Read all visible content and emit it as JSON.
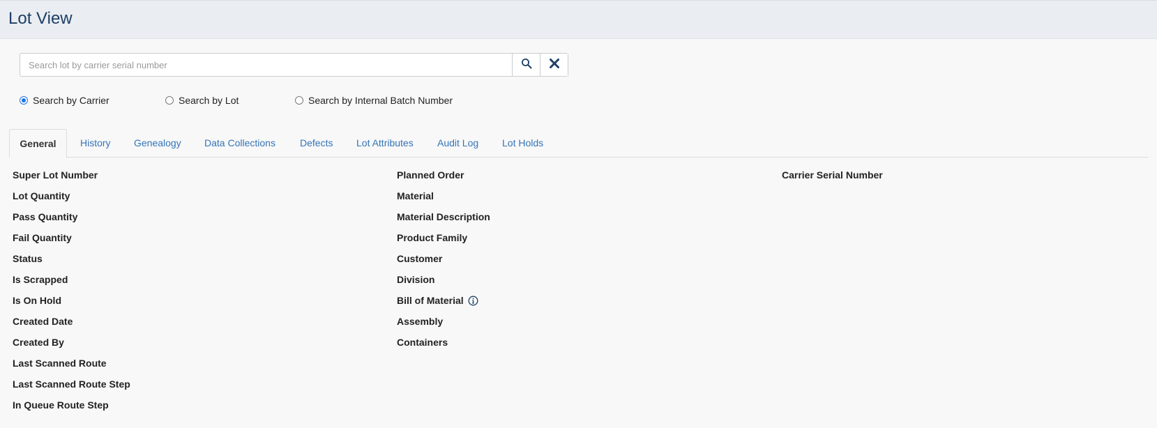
{
  "header": {
    "title": "Lot View"
  },
  "search": {
    "placeholder": "Search lot by carrier serial number",
    "value": "",
    "search_icon": "search-icon",
    "clear_icon": "close-icon"
  },
  "search_modes": [
    {
      "label": "Search by Carrier",
      "checked": true
    },
    {
      "label": "Search by Lot",
      "checked": false
    },
    {
      "label": "Search by Internal Batch Number",
      "checked": false
    }
  ],
  "tabs": [
    {
      "label": "General",
      "active": true
    },
    {
      "label": "History",
      "active": false
    },
    {
      "label": "Genealogy",
      "active": false
    },
    {
      "label": "Data Collections",
      "active": false
    },
    {
      "label": "Defects",
      "active": false
    },
    {
      "label": "Lot Attributes",
      "active": false
    },
    {
      "label": "Audit Log",
      "active": false
    },
    {
      "label": "Lot Holds",
      "active": false
    }
  ],
  "general": {
    "column1": [
      "Super Lot Number",
      "Lot Quantity",
      "Pass Quantity",
      "Fail Quantity",
      "Status",
      "Is Scrapped",
      "Is On Hold",
      "Created Date",
      "Created By",
      "Last Scanned Route",
      "Last Scanned Route Step",
      "In Queue Route Step"
    ],
    "column2": [
      "Planned Order",
      "Material",
      "Material Description",
      "Product Family",
      "Customer",
      "Division",
      "Bill of Material",
      "Assembly",
      "Containers"
    ],
    "column3": [
      "Carrier Serial Number"
    ],
    "bom_info_icon": "info-icon"
  },
  "colors": {
    "title": "#1d3f66",
    "tab_link": "#3474b8",
    "radio_checked": "#1a73e8",
    "header_bg": "#eaedf1",
    "page_bg": "#f8f8f8"
  }
}
